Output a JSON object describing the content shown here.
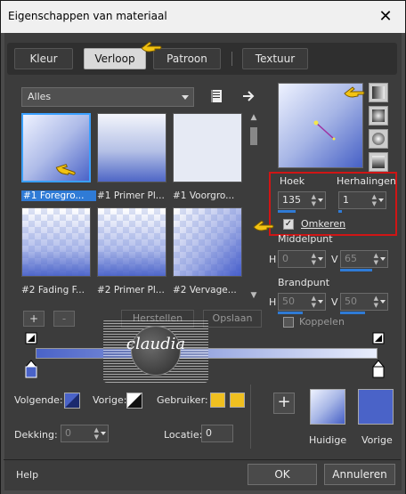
{
  "window": {
    "title": "Eigenschappen van materiaal",
    "close_glyph": "✕"
  },
  "tabs": [
    {
      "label": "Kleur",
      "active": false
    },
    {
      "label": "Verloop",
      "active": true
    },
    {
      "label": "Patroon",
      "active": false
    },
    {
      "label": "Textuur",
      "active": false
    }
  ],
  "library": {
    "category": "Alles",
    "gradients": [
      {
        "label": "#1 Foregro...",
        "selected": true
      },
      {
        "label": "#1 Primer Pl...",
        "selected": false
      },
      {
        "label": "#1 Voorgro...",
        "selected": false
      },
      {
        "label": "#2 Fading F...",
        "selected": false
      },
      {
        "label": "#2 Primer Pl...",
        "selected": false
      },
      {
        "label": "#2 Vervage...",
        "selected": false
      }
    ],
    "add_label": "+",
    "remove_label": "-",
    "restore_label": "Herstellen",
    "save_label": "Opslaan"
  },
  "settings": {
    "angle_label": "Hoek",
    "angle_value": "135",
    "repeats_label": "Herhalingen",
    "repeats_value": "1",
    "invert_label": "Omkeren",
    "invert_checked": true,
    "midpoint_label": "Middelpunt",
    "midpoint_h_label": "H",
    "midpoint_h_value": "0",
    "midpoint_v_label": "V",
    "midpoint_v_value": "65",
    "focus_label": "Brandpunt",
    "focus_h_label": "H",
    "focus_h_value": "50",
    "focus_v_label": "V",
    "focus_v_value": "50",
    "link_label": "Koppelen",
    "link_checked": false
  },
  "editor": {
    "next_label": "Volgende:",
    "prev_label": "Vorige:",
    "user_label": "Gebruiker:",
    "opacity_label": "Dekking:",
    "opacity_value": "0",
    "location_label": "Locatie:",
    "location_value": "0",
    "user_color_1": "#f0c020",
    "user_color_2": "#f0c020"
  },
  "swatches": {
    "add_glyph": "+",
    "current_label": "Huidige",
    "previous_label": "Vorige"
  },
  "watermark": {
    "text": "claudia"
  },
  "footer": {
    "help_label": "Help",
    "ok_label": "OK",
    "cancel_label": "Annuleren"
  },
  "colors": {
    "accent": "#2f7bd6",
    "highlight": "#d01515",
    "gradient_dark": "#4a63c8",
    "gradient_light": "#e9eefc"
  }
}
